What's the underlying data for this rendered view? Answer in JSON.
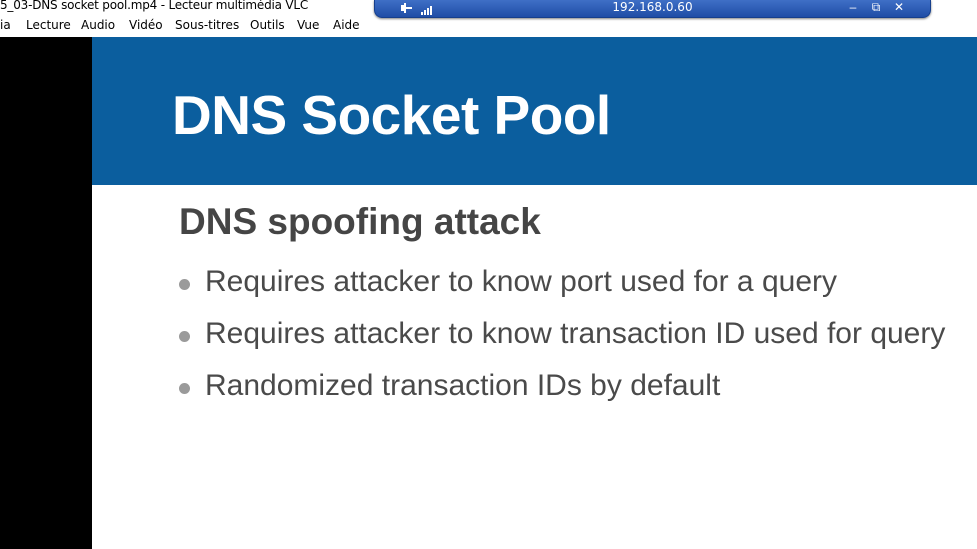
{
  "window": {
    "title": "5_03-DNS socket pool.mp4 - Lecteur multimédia VLC"
  },
  "menu": {
    "items": [
      "ia",
      "Lecture",
      "Audio",
      "Vidéo",
      "Sous-titres",
      "Outils",
      "Vue",
      "Aide"
    ]
  },
  "remote_bar": {
    "address": "192.168.0.60",
    "minimize_label": "–",
    "restore_label": "⧉",
    "close_label": "✕",
    "icons": [
      "pin-icon",
      "signal-icon"
    ]
  },
  "slide": {
    "title": "DNS Socket Pool",
    "subtitle": "DNS spoofing attack",
    "bullets": [
      "Requires attacker to know port used for a query",
      "Requires attacker to know transaction ID used for query",
      "Randomized transaction IDs by default"
    ],
    "header_color": "#0b5e9e"
  }
}
